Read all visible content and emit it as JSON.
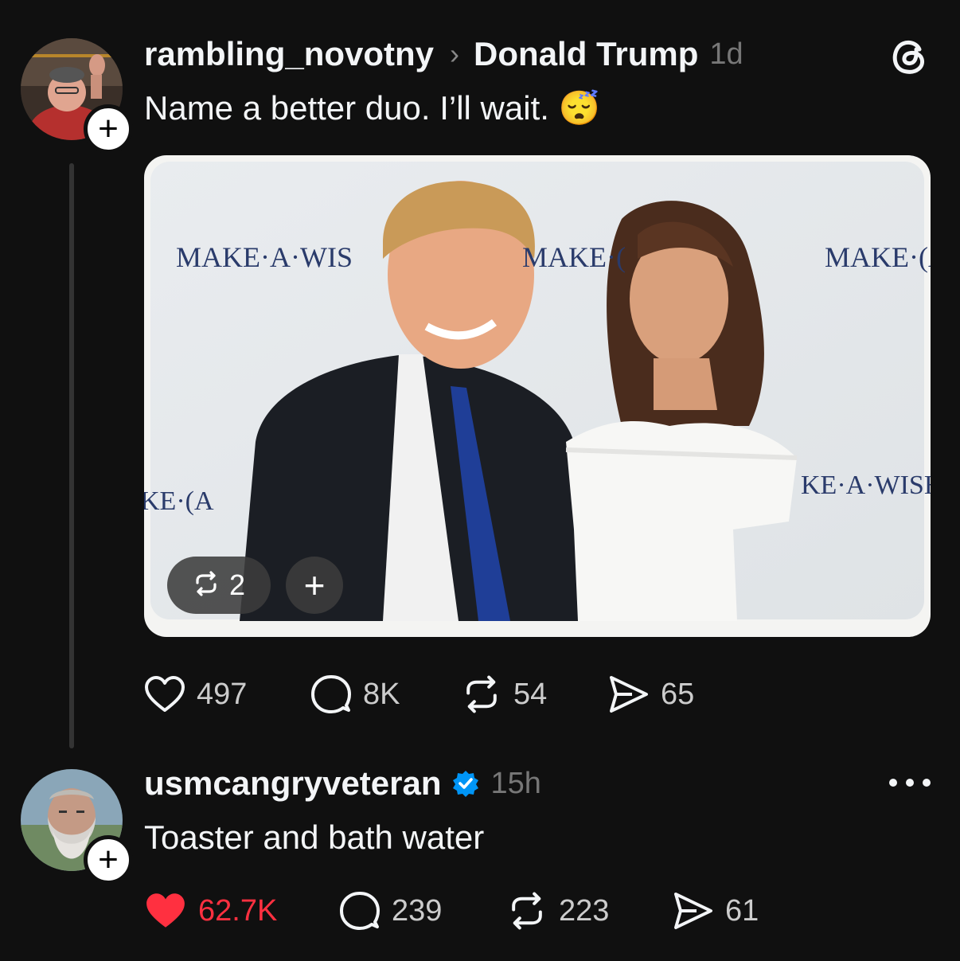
{
  "post": {
    "author": "rambling_novotny",
    "reply_to": "Donald Trump",
    "time": "1d",
    "text": "Name a better duo. I’ll wait. 😴",
    "image": {
      "banner_texts": [
        "MAKE·A·WIS",
        "MAKE·(",
        "MAKE·(A",
        "KE·(A",
        "KE·A·WISH"
      ],
      "requote_count": "2"
    },
    "stats": {
      "likes": "497",
      "replies": "8K",
      "reposts": "54",
      "shares": "65"
    }
  },
  "reply": {
    "author": "usmcangryveteran",
    "time": "15h",
    "text": "Toaster and bath water",
    "stats": {
      "likes": "62.7K",
      "replies": "239",
      "reposts": "223",
      "shares": "61"
    }
  },
  "colors": {
    "background": "#101010",
    "liked": "#ff3040",
    "verified": "#0095f6"
  },
  "icons": [
    "threads-logo-icon",
    "heart-icon",
    "comment-icon",
    "repost-icon",
    "share-icon",
    "verified-icon",
    "more-icon",
    "plus-icon"
  ]
}
